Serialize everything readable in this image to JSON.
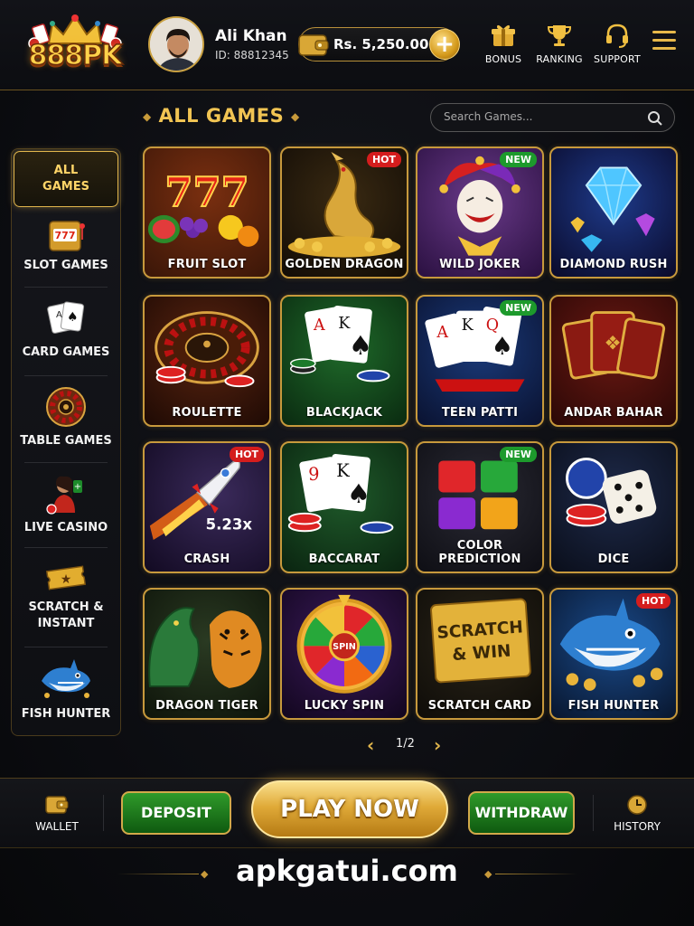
{
  "brand": {
    "logo_text": "888PK"
  },
  "user": {
    "name": "Ali Khan",
    "id_text": "ID: 88812345"
  },
  "balance": {
    "amount": "Rs. 5,250.00",
    "add_label": "+"
  },
  "header_nav": [
    {
      "label": "BONUS",
      "icon": "gift-icon"
    },
    {
      "label": "RANKING",
      "icon": "trophy-icon"
    },
    {
      "label": "SUPPORT",
      "icon": "headset-icon"
    }
  ],
  "section": {
    "title": "ALL GAMES"
  },
  "search": {
    "placeholder": "Search Games..."
  },
  "sidebar": [
    {
      "label": "ALL GAMES",
      "active": true
    },
    {
      "label": "SLOT GAMES",
      "icon": "slot-machine-icon"
    },
    {
      "label": "CARD GAMES",
      "icon": "cards-icon"
    },
    {
      "label": "TABLE GAMES",
      "icon": "roulette-icon"
    },
    {
      "label": "LIVE CASINO",
      "icon": "dealer-icon"
    },
    {
      "label": "SCRATCH & INSTANT",
      "icon": "ticket-icon"
    },
    {
      "label": "FISH HUNTER",
      "icon": "shark-icon"
    }
  ],
  "games": [
    {
      "title": "FRUIT SLOT",
      "badge": ""
    },
    {
      "title": "GOLDEN DRAGON",
      "badge": "HOT"
    },
    {
      "title": "WILD JOKER",
      "badge": "NEW"
    },
    {
      "title": "DIAMOND RUSH",
      "badge": ""
    },
    {
      "title": "ROULETTE",
      "badge": ""
    },
    {
      "title": "BLACKJACK",
      "badge": ""
    },
    {
      "title": "TEEN PATTI",
      "badge": "NEW"
    },
    {
      "title": "ANDAR BAHAR",
      "badge": ""
    },
    {
      "title": "CRASH",
      "badge": "HOT"
    },
    {
      "title": "BACCARAT",
      "badge": ""
    },
    {
      "title": "COLOR PREDICTION",
      "badge": "NEW"
    },
    {
      "title": "DICE",
      "badge": ""
    },
    {
      "title": "DRAGON TIGER",
      "badge": ""
    },
    {
      "title": "LUCKY SPIN",
      "badge": ""
    },
    {
      "title": "SCRATCH CARD",
      "badge": ""
    },
    {
      "title": "FISH HUNTER",
      "badge": "HOT"
    }
  ],
  "game_art_text": {
    "fruit_slot": "777",
    "crash_multiplier": "5.23x",
    "lucky_spin_center": "SPIN",
    "scratch_line1": "SCRATCH",
    "scratch_line2": "& WIN",
    "card_a": "A",
    "card_k": "K",
    "card_q": "Q",
    "card_9": "9"
  },
  "pager": {
    "text": "1/2",
    "prev": "‹",
    "next": "›"
  },
  "bottom": {
    "wallet_label": "WALLET",
    "deposit_label": "DEPOSIT",
    "play_label": "PLAY NOW",
    "withdraw_label": "WITHDRAW",
    "history_label": "HISTORY"
  },
  "footer": {
    "text": "apkgatui.com"
  },
  "colors": {
    "gold": "#e0b54c",
    "hot": "#d41d1d",
    "new": "#1d9a2c",
    "green_button": "#2f9a2a"
  }
}
